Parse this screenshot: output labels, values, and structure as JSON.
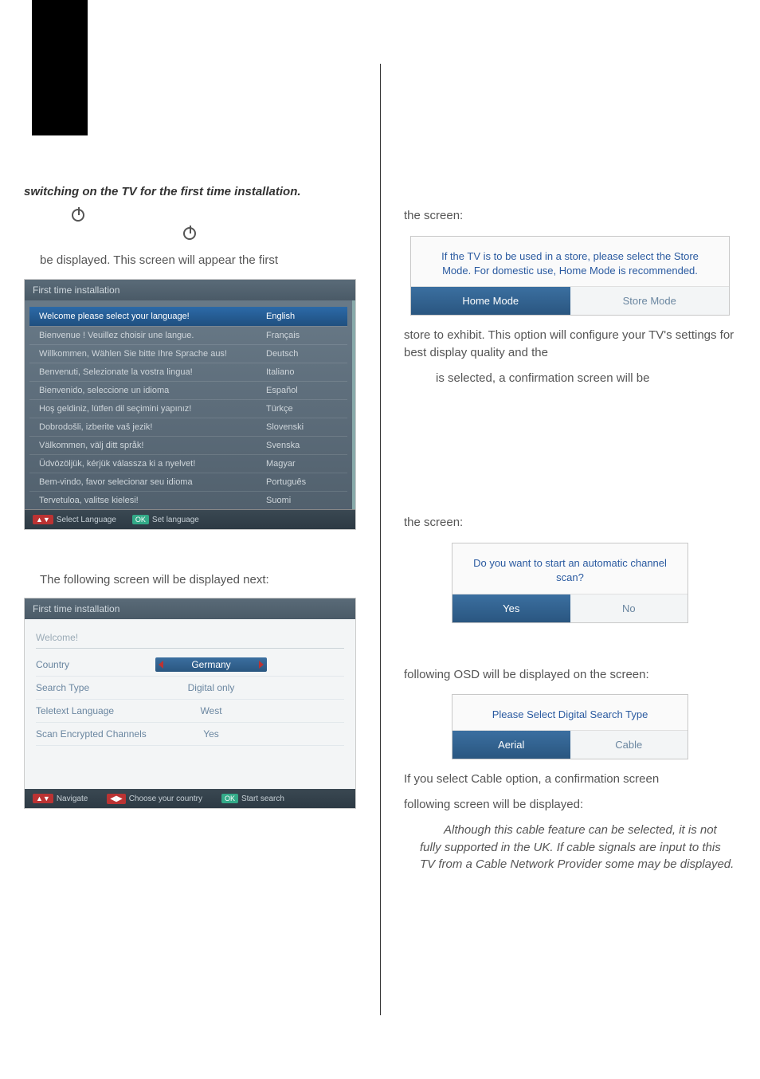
{
  "left": {
    "heading_bold": "switching on the TV for the first time installation.",
    "displayed_line": "be displayed. This screen will appear the first",
    "lang_panel": {
      "title": "First time installation",
      "header_left": "Welcome please select your language!",
      "header_right": "English",
      "rows": [
        {
          "left": "Bienvenue ! Veuillez choisir une langue.",
          "right": "Français"
        },
        {
          "left": "Willkommen, Wählen Sie bitte Ihre Sprache aus!",
          "right": "Deutsch"
        },
        {
          "left": "Benvenuti, Selezionate la vostra lingua!",
          "right": "Italiano"
        },
        {
          "left": "Bienvenido, seleccione un idioma",
          "right": "Español"
        },
        {
          "left": "Hoş geldiniz, lütfen dil seçimini yapınız!",
          "right": "Türkçe"
        },
        {
          "left": "Dobrodošli, izberite vaš jezik!",
          "right": "Slovenski"
        },
        {
          "left": "Välkommen, välj ditt språk!",
          "right": "Svenska"
        },
        {
          "left": "Üdvözöljük, kérjük válassza ki a nyelvet!",
          "right": "Magyar"
        },
        {
          "left": "Bem-vindo, favor selecionar seu idioma",
          "right": "Português"
        },
        {
          "left": "Tervetuloa, valitse kielesi!",
          "right": "Suomi"
        }
      ],
      "footer_select": "Select Language",
      "footer_set": "Set language"
    },
    "following_line": "The following screen will be displayed next:",
    "install_panel": {
      "title": "First time installation",
      "welcome": "Welcome!",
      "rows": [
        {
          "label": "Country",
          "value": "Germany",
          "pill": true
        },
        {
          "label": "Search Type",
          "value": "Digital only",
          "pill": false
        },
        {
          "label": "Teletext Language",
          "value": "West",
          "pill": false
        },
        {
          "label": "Scan Encrypted Channels",
          "value": "Yes",
          "pill": false
        }
      ],
      "footer_nav": "Navigate",
      "footer_choose": "Choose your country",
      "footer_start": "Start search"
    }
  },
  "right": {
    "the_screen_1": "the screen:",
    "mode_dialog": {
      "text": "If the TV is to be used in a store, please select the Store Mode. For domestic use, Home Mode is recommended.",
      "btn_home": "Home Mode",
      "btn_store": "Store Mode"
    },
    "store_line_1": "store to exhibit. This option will configure your TV's settings for best display quality and the",
    "confirm_line": "is selected, a confirmation screen will be",
    "the_screen_2": "the screen:",
    "scan_dialog": {
      "text": "Do you want to start an automatic channel scan?",
      "btn_yes": "Yes",
      "btn_no": "No"
    },
    "osd_line": "following OSD will be displayed on the screen:",
    "search_dialog": {
      "text": "Please Select Digital Search Type",
      "btn_aerial": "Aerial",
      "btn_cable": "Cable"
    },
    "cable_line_1": "If you select Cable option, a confirmation screen",
    "cable_line_2": "following screen will be displayed:",
    "note_italic": "Although this cable feature can be selected, it is not fully supported in the UK. If cable signals are input to this TV from a Cable Network Provider some may be displayed."
  }
}
